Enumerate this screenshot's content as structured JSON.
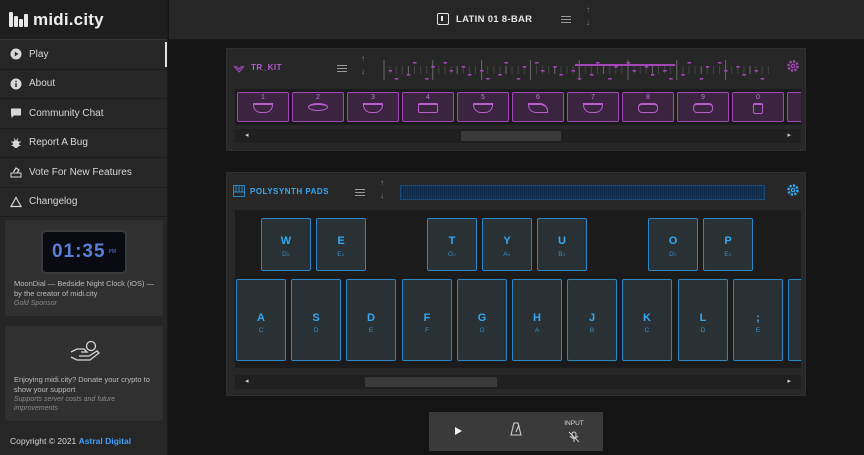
{
  "brand": {
    "name": "midi.city"
  },
  "sidebar": {
    "items": [
      {
        "label": "Play",
        "icon": "play-circle-icon",
        "active": true
      },
      {
        "label": "About",
        "icon": "info-icon",
        "active": false
      },
      {
        "label": "Community Chat",
        "icon": "chat-icon",
        "active": false
      },
      {
        "label": "Report A Bug",
        "icon": "bug-icon",
        "active": false
      },
      {
        "label": "Vote For New Features",
        "icon": "vote-icon",
        "active": false
      },
      {
        "label": "Changelog",
        "icon": "triangle-icon",
        "active": false
      }
    ],
    "sponsor": {
      "clock_time": "01:35",
      "clock_ampm": "PM",
      "title": "MoonDial — Bedside Night Clock (iOS) — by the creator of midi.city",
      "subtitle": "Gold Sponsor"
    },
    "donate": {
      "text": "Enjoying midi.city? Donate your crypto to show your support",
      "subtext": "Supports server costs and future improvements"
    },
    "copyright_prefix": "Copyright © 2021",
    "copyright_company": "Astral Digital"
  },
  "topbar": {
    "song_title": "LATIN 01 8-BAR"
  },
  "drum_panel": {
    "title": "TR_KIT",
    "accent": "#a347b8",
    "pads": [
      "1",
      "2",
      "3",
      "4",
      "5",
      "6",
      "7",
      "8",
      "9",
      "0"
    ]
  },
  "synth_panel": {
    "title": "POLYSYNTH PADS",
    "accent": "#2b88c8",
    "black_keys": [
      {
        "key": "W",
        "note": "D♭"
      },
      {
        "key": "E",
        "note": "E♭"
      },
      {
        "key": "T",
        "note": "G♭"
      },
      {
        "key": "Y",
        "note": "A♭"
      },
      {
        "key": "U",
        "note": "B♭"
      },
      {
        "key": "O",
        "note": "D♭"
      },
      {
        "key": "P",
        "note": "E♭"
      }
    ],
    "white_keys": [
      {
        "key": "A",
        "note": "C"
      },
      {
        "key": "S",
        "note": "D"
      },
      {
        "key": "D",
        "note": "E"
      },
      {
        "key": "F",
        "note": "F"
      },
      {
        "key": "G",
        "note": "G"
      },
      {
        "key": "H",
        "note": "A"
      },
      {
        "key": "J",
        "note": "B"
      },
      {
        "key": "K",
        "note": "C"
      },
      {
        "key": "L",
        "note": "D"
      },
      {
        "key": ";",
        "note": "E"
      }
    ]
  },
  "transport": {
    "input_label": "INPUT"
  }
}
